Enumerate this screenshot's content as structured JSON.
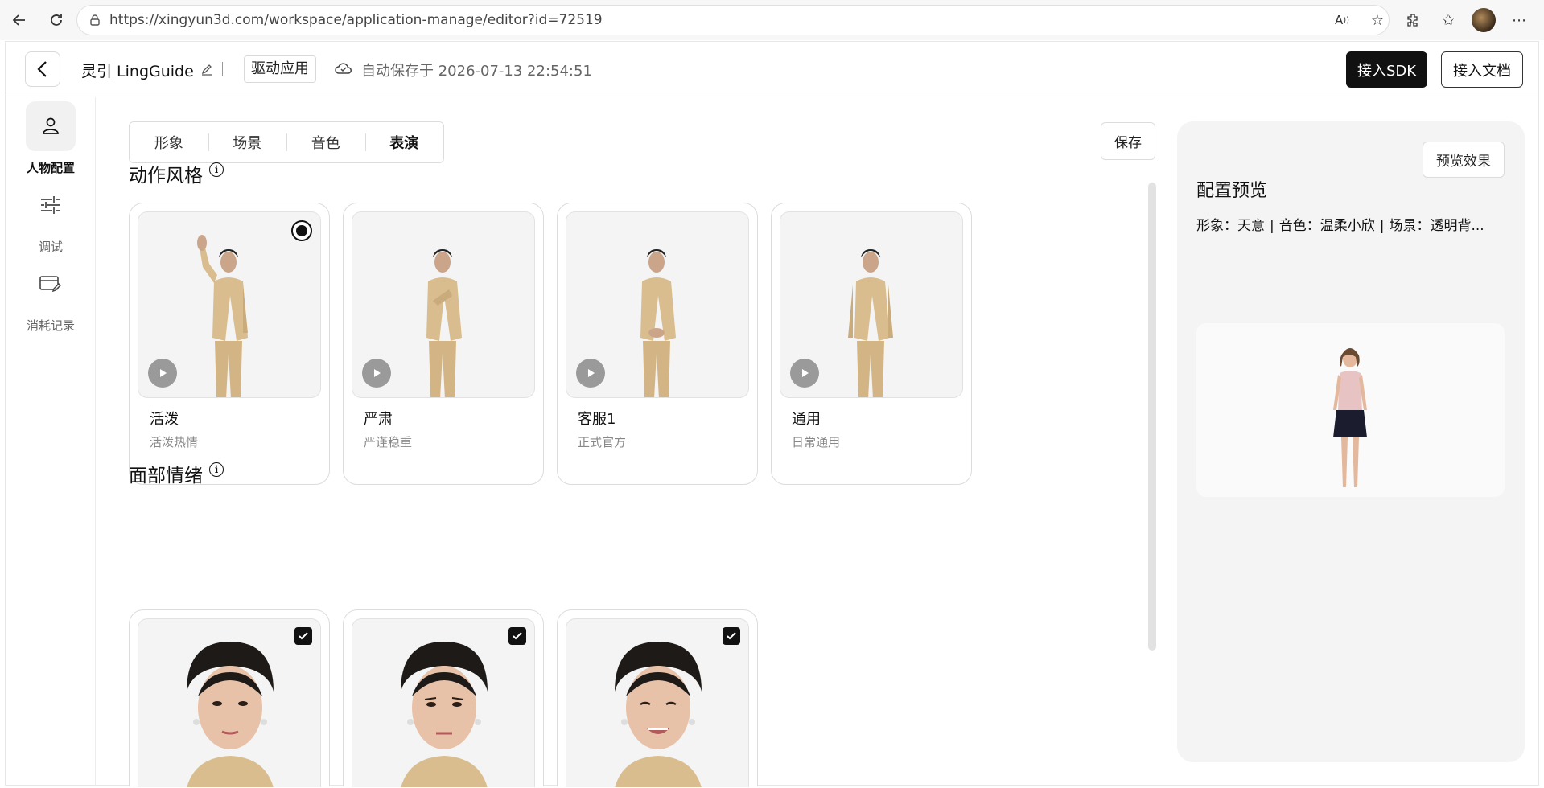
{
  "browser": {
    "url": "https://xingyun3d.com/workspace/application-manage/editor?id=72519"
  },
  "header": {
    "app_name": "灵引 LingGuide",
    "tag": "驱动应用",
    "autosave": "自动保存于 2026-07-13 22:54:51",
    "sdk_button": "接入SDK",
    "docs_button": "接入文档"
  },
  "sidebar": {
    "items": [
      {
        "label": "人物配置",
        "icon": "person-icon",
        "active": true
      },
      {
        "label": "调试",
        "icon": "sliders-icon",
        "active": false
      },
      {
        "label": "消耗记录",
        "icon": "card-edit-icon",
        "active": false
      }
    ]
  },
  "tabs": [
    "形象",
    "场景",
    "音色",
    "表演"
  ],
  "active_tab": "表演",
  "save_button": "保存",
  "motion_section": {
    "title": "动作风格",
    "cards": [
      {
        "name": "活泼",
        "desc": "活泼热情",
        "selected": true
      },
      {
        "name": "严肃",
        "desc": "严谨稳重",
        "selected": false
      },
      {
        "name": "客服1",
        "desc": "正式官方",
        "selected": false
      },
      {
        "name": "通用",
        "desc": "日常通用",
        "selected": false
      }
    ]
  },
  "emotion_section": {
    "title": "面部情绪",
    "cards": [
      {
        "checked": true
      },
      {
        "checked": true
      },
      {
        "checked": true
      }
    ]
  },
  "preview": {
    "button": "预览效果",
    "title": "配置预览",
    "image_label": "形象：天意",
    "voice_label": "音色：温柔小欣",
    "scene_label": "场景：透明背...",
    "separator": "|"
  },
  "colors": {
    "primary_dark": "#111111",
    "panel_bg": "#f4f4f4",
    "suit": "#d9bd8e"
  }
}
